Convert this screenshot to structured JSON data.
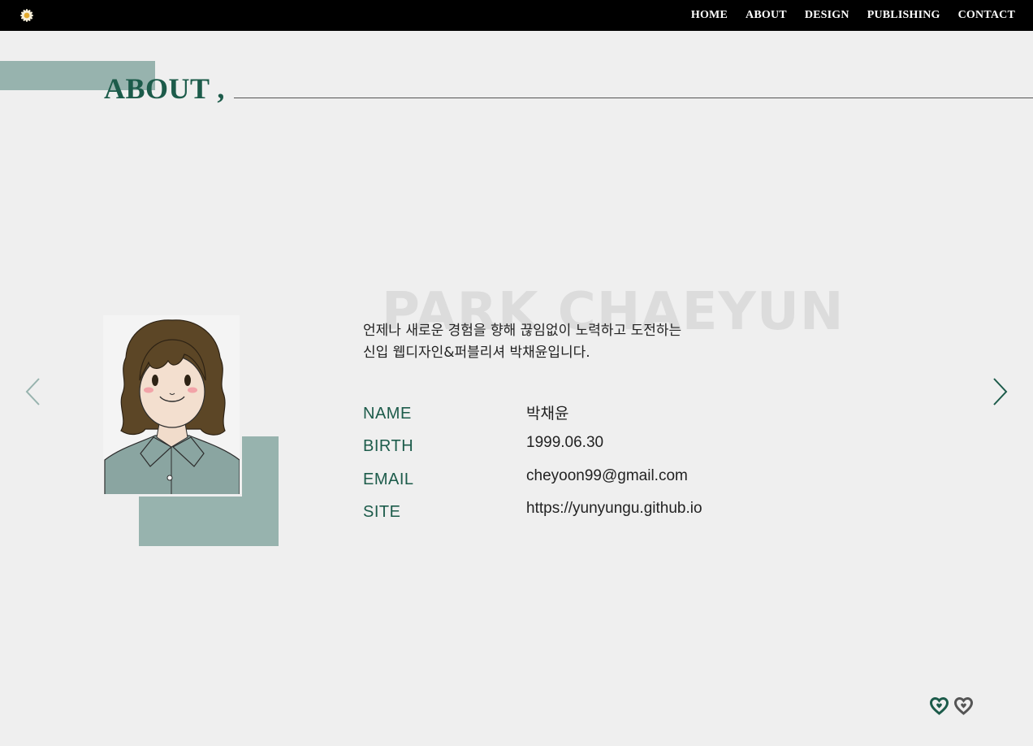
{
  "nav": {
    "logo_icon": "flower-icon",
    "items": [
      {
        "label": "HOME"
      },
      {
        "label": "ABOUT"
      },
      {
        "label": "DESIGN"
      },
      {
        "label": "PUBLISHING"
      },
      {
        "label": "CONTACT"
      }
    ]
  },
  "section": {
    "title": "ABOUT ,"
  },
  "profile": {
    "watermark": "PARK CHAEYUN",
    "intro_line1": "언제나 새로운 경험을 향해 끊임없이 노력하고 도전하는",
    "intro_line2": "신입 웹디자인&퍼블리셔 박채윤입니다.",
    "info": [
      {
        "label": "NAME",
        "value": "박채윤"
      },
      {
        "label": "BIRTH",
        "value": "1999.06.30"
      },
      {
        "label": "EMAIL",
        "value": "cheyoon99@gmail.com"
      },
      {
        "label": "SITE",
        "value": "https://yunyungu.github.io"
      }
    ]
  },
  "colors": {
    "accent": "#1c5b4a",
    "block": "#97b3ae",
    "background": "#efefef",
    "topbar": "#000000"
  },
  "icons": {
    "prev": "chevron-left-icon",
    "next": "chevron-right-icon",
    "like": "heart-icon"
  }
}
